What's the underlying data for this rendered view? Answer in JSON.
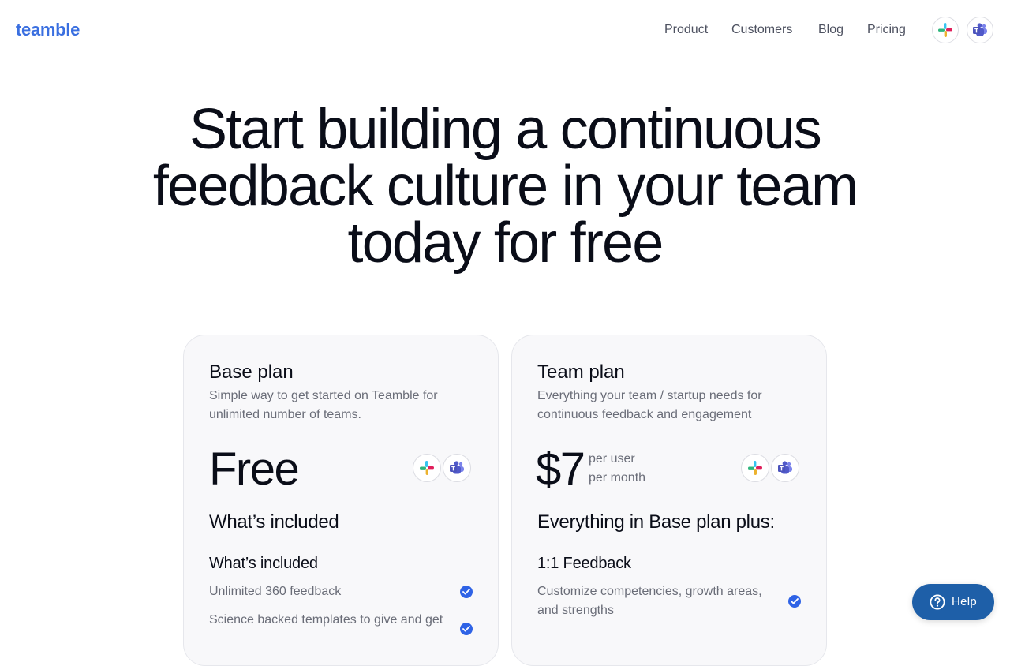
{
  "header": {
    "logo": "teamble",
    "nav": [
      "Product",
      "Customers",
      "Blog",
      "Pricing"
    ],
    "integrations": [
      "slack-icon",
      "microsoft-teams-icon"
    ]
  },
  "hero": {
    "lines": [
      "Start building a continuous",
      "feedback culture in your team",
      "today for free"
    ]
  },
  "plans": [
    {
      "title": "Base plan",
      "description": "Simple way to get started on Teamble for unlimited number of teams.",
      "price": "Free",
      "price_suffix": "",
      "section_heading": "What’s included",
      "group_heading": "What’s included",
      "features": [
        "Unlimited 360 feedback",
        "Science backed templates to give and get"
      ]
    },
    {
      "title": "Team plan",
      "description": "Everything your team / startup needs for continuous feedback and engagement",
      "price": "$7",
      "price_suffix_line1": "per user",
      "price_suffix_line2": "per month",
      "section_heading": "Everything in Base plan plus:",
      "group_heading": "1:1 Feedback",
      "features": [
        "Customize competencies, growth areas, and strengths"
      ]
    }
  ],
  "help": {
    "label": "Help"
  },
  "colors": {
    "brand": "#3a6fe0",
    "check": "#2f63e6",
    "help_button": "#1e5fa8"
  }
}
